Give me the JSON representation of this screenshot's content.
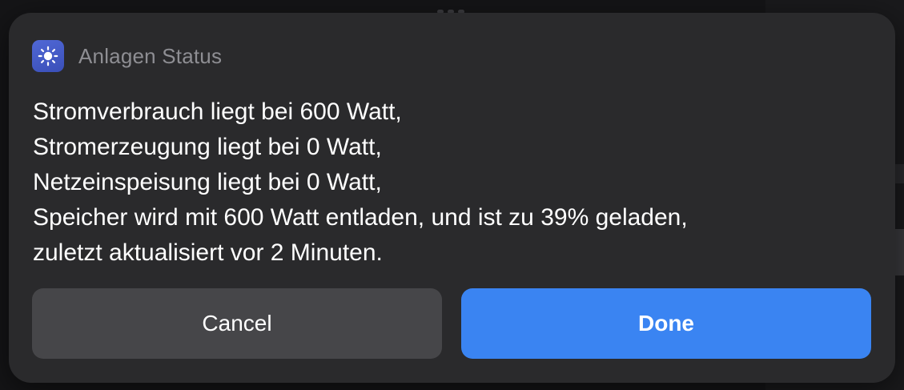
{
  "dialog": {
    "app_icon": "sun-icon",
    "app_title": "Anlagen Status",
    "message_lines": [
      "Stromverbrauch liegt bei 600 Watt,",
      "Stromerzeugung liegt bei 0 Watt,",
      "Netzeinspeisung liegt bei 0 Watt,",
      "Speicher wird mit 600 Watt entladen, und ist zu 39% geladen,",
      "zuletzt aktualisiert vor 2 Minuten."
    ],
    "cancel_label": "Cancel",
    "done_label": "Done"
  },
  "colors": {
    "dialog_background": "#2a2a2c",
    "cancel_button": "#464649",
    "done_button": "#3a84f2",
    "app_icon": "#4a60cc",
    "title_text": "#8e8e93"
  }
}
